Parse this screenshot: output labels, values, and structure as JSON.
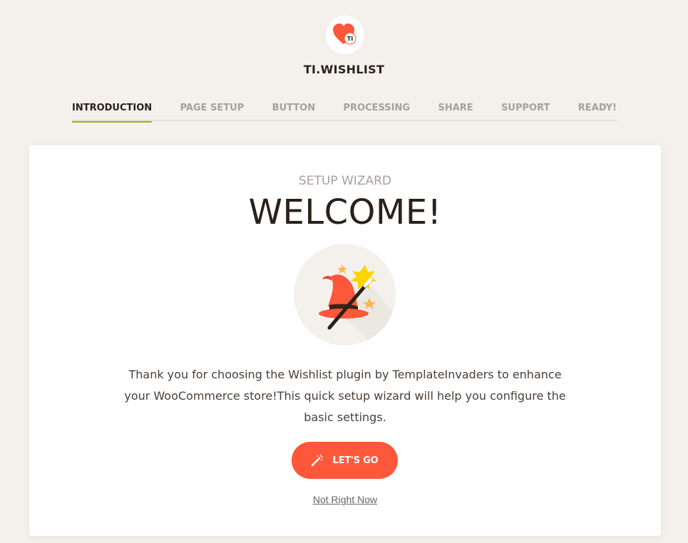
{
  "brand": {
    "title": "TI.WISHLIST",
    "logo_badge_text": "TI",
    "logo_icon": "heart-logo-icon",
    "accent_color": "#ff5739"
  },
  "steps": [
    {
      "label": "INTRODUCTION",
      "active": true
    },
    {
      "label": "PAGE SETUP",
      "active": false
    },
    {
      "label": "BUTTON",
      "active": false
    },
    {
      "label": "PROCESSING",
      "active": false
    },
    {
      "label": "SHARE",
      "active": false
    },
    {
      "label": "SUPPORT",
      "active": false
    },
    {
      "label": "READY!",
      "active": false
    }
  ],
  "step_active_color": "#a2b218",
  "card": {
    "subtitle": "SETUP WIZARD",
    "heading": "WELCOME!",
    "illustration_icon": "wizard-hat-icon",
    "intro_text": "Thank you for choosing the Wishlist plugin by TemplateInvaders to enhance your WooCommerce store!This quick setup wizard will help you configure the basic settings.",
    "primary_button": {
      "label": "LET'S GO",
      "icon": "magic-wand-icon"
    },
    "skip_link": "Not Right Now"
  }
}
